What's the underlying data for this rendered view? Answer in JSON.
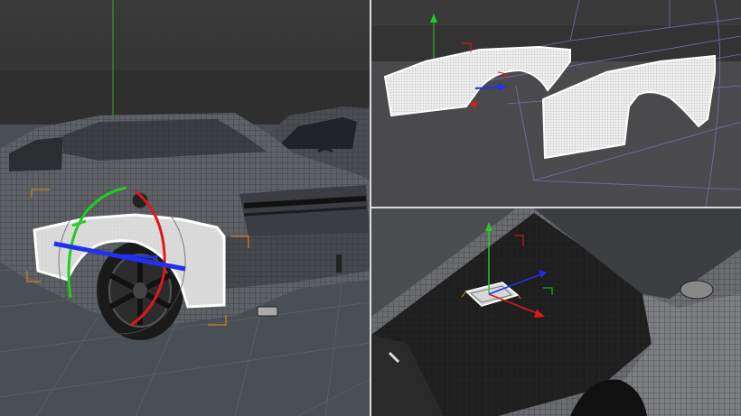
{
  "layout": "three-viewport",
  "viewports": [
    {
      "id": "perspective-main",
      "content": "car-rear-quarter-with-selected-fender"
    },
    {
      "id": "isolated-fenders",
      "content": "two-fender-panels-wireframe"
    },
    {
      "id": "hood-view",
      "content": "car-hood-with-selected-object"
    }
  ],
  "colors": {
    "background": "#3a3a3a",
    "mesh": "#8a8a8a",
    "mesh_dark": "#1a1a1a",
    "selection": "#ffffff",
    "axis_x": "#e01818",
    "axis_y": "#22cc22",
    "axis_z": "#2030ee",
    "bbox": "#7070b0",
    "bbox_orange": "#d08020",
    "divider": "#dcdcdc"
  },
  "icons": [
    "move-gizmo-icon",
    "rotate-gizmo-icon"
  ]
}
